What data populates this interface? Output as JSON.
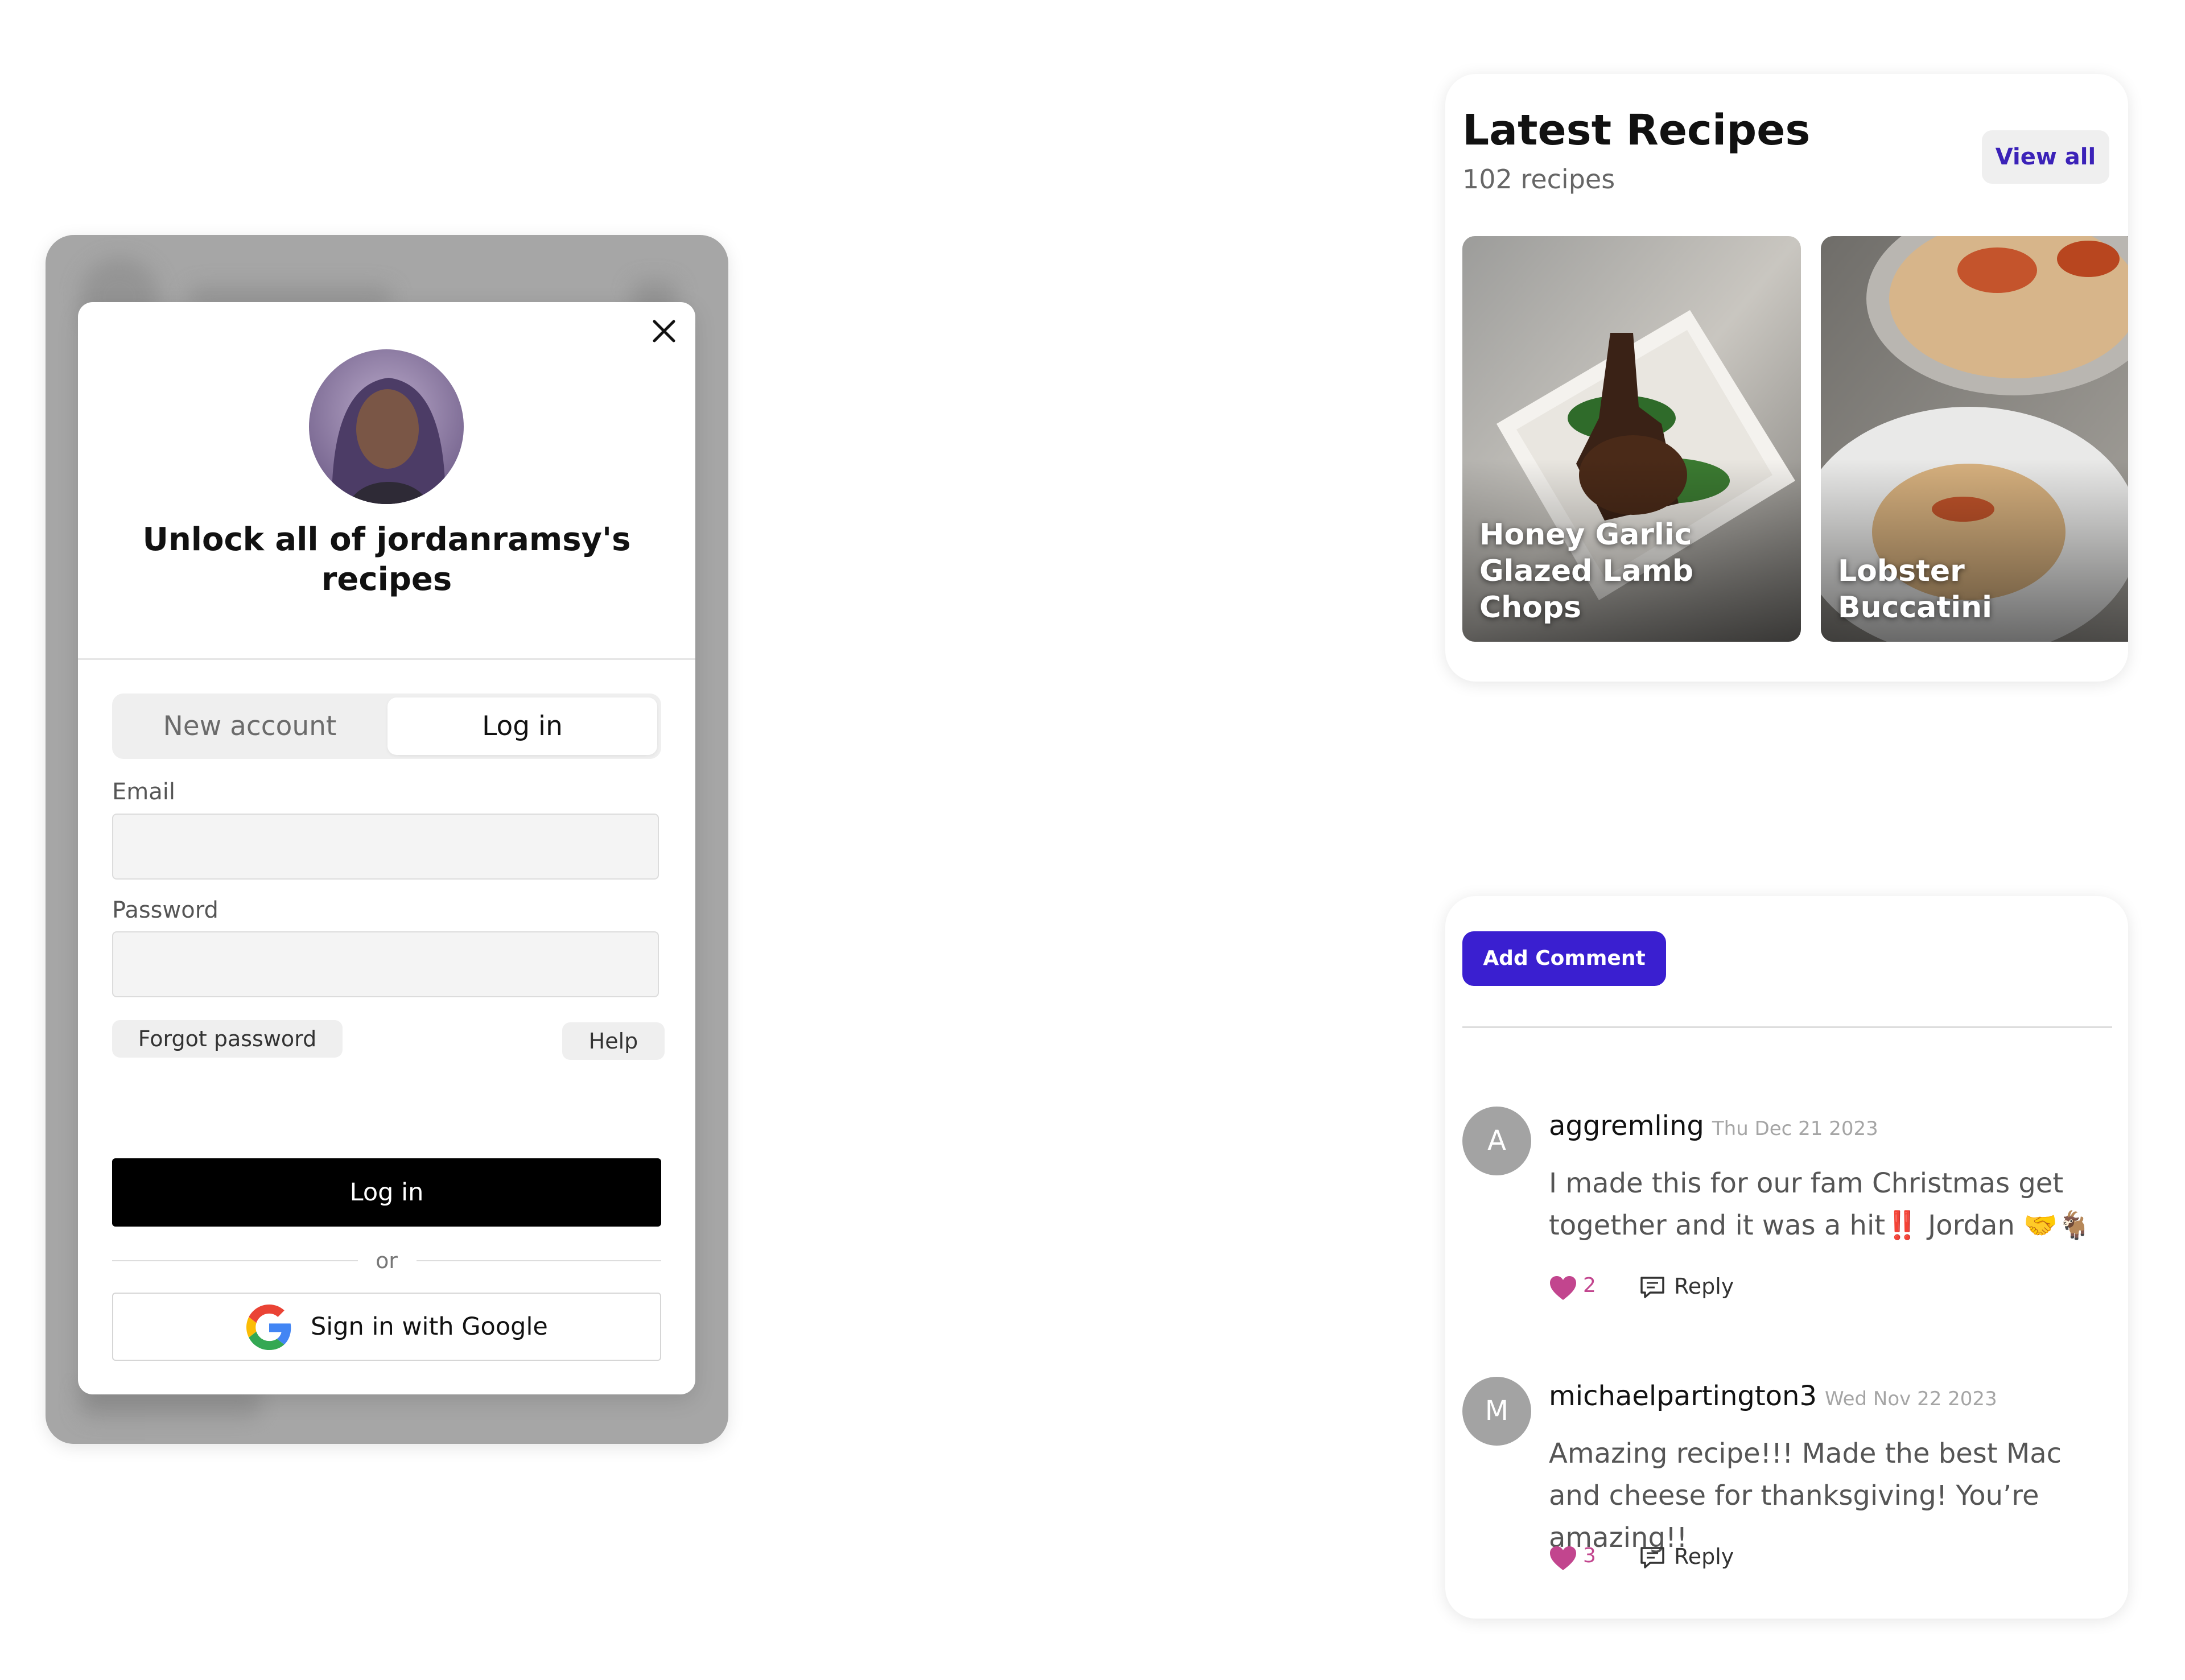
{
  "login": {
    "title": "Unlock all of jordanramsy's recipes",
    "tabs": {
      "new_account": "New account",
      "log_in": "Log in",
      "active": "log_in"
    },
    "email_label": "Email",
    "email_value": "",
    "password_label": "Password",
    "password_value": "",
    "forgot_password": "Forgot password",
    "help": "Help",
    "submit_label": "Log in",
    "or_text": "or",
    "google_label": "Sign in with Google"
  },
  "recipes": {
    "title": "Latest Recipes",
    "count": "102 recipes",
    "view_all": "View all",
    "items": [
      {
        "name": "Honey Garlic Glazed Lamb Chops"
      },
      {
        "name": "Lobster Buccatini"
      }
    ]
  },
  "comments": {
    "add_button": "Add Comment",
    "items": [
      {
        "initial": "A",
        "user": "aggremling",
        "date": "Thu Dec 21 2023",
        "text": "I made this for our fam Christmas get together and it was a hit‼️ Jordan 🤝🐐",
        "likes": "2",
        "reply": "Reply"
      },
      {
        "initial": "M",
        "user": "michaelpartington3",
        "date": "Wed Nov 22 2023",
        "text": "Amazing recipe!!! Made the best Mac and cheese for thanksgiving! You’re amazing!!",
        "likes": "3",
        "reply": "Reply"
      }
    ]
  },
  "colors": {
    "accent": "#3a1fd0",
    "heart": "#c2458e",
    "backdrop": "#a6a6a6"
  }
}
